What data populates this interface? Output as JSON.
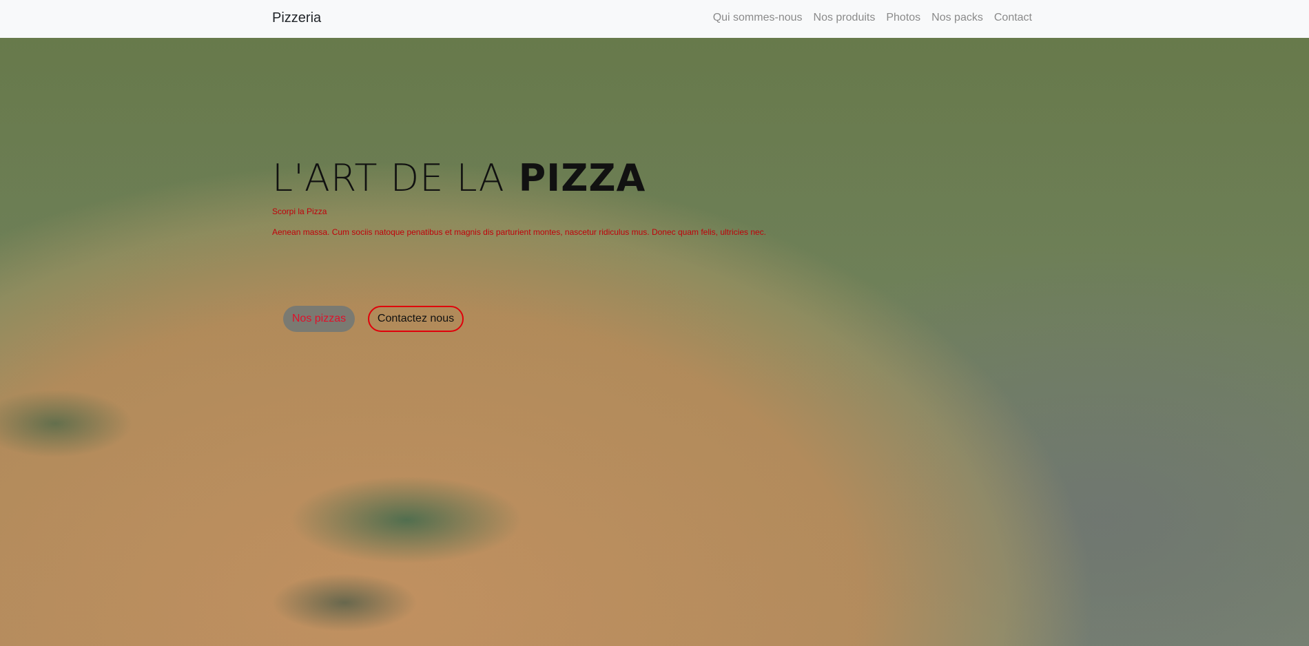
{
  "navbar": {
    "brand": "Pizzeria",
    "links": [
      "Qui sommes-nous",
      "Nos produits",
      "Photos",
      "Nos packs",
      "Contact"
    ]
  },
  "hero": {
    "title_light": "L'ART DE LA",
    "title_bold": "PIZZA",
    "subtitle": "Scorpi la Pizza",
    "text": "Aenean massa. Cum sociis natoque penatibus et magnis dis parturient montes, nascetur ridiculus mus. Donec quam felis, ultricies nec.",
    "primary_button": "Nos pizzas",
    "outline_button": "Contactez nous"
  },
  "colors": {
    "navbar_bg": "#f8f9fa",
    "accent_red": "#e0000a",
    "text_red": "#c0000a"
  }
}
